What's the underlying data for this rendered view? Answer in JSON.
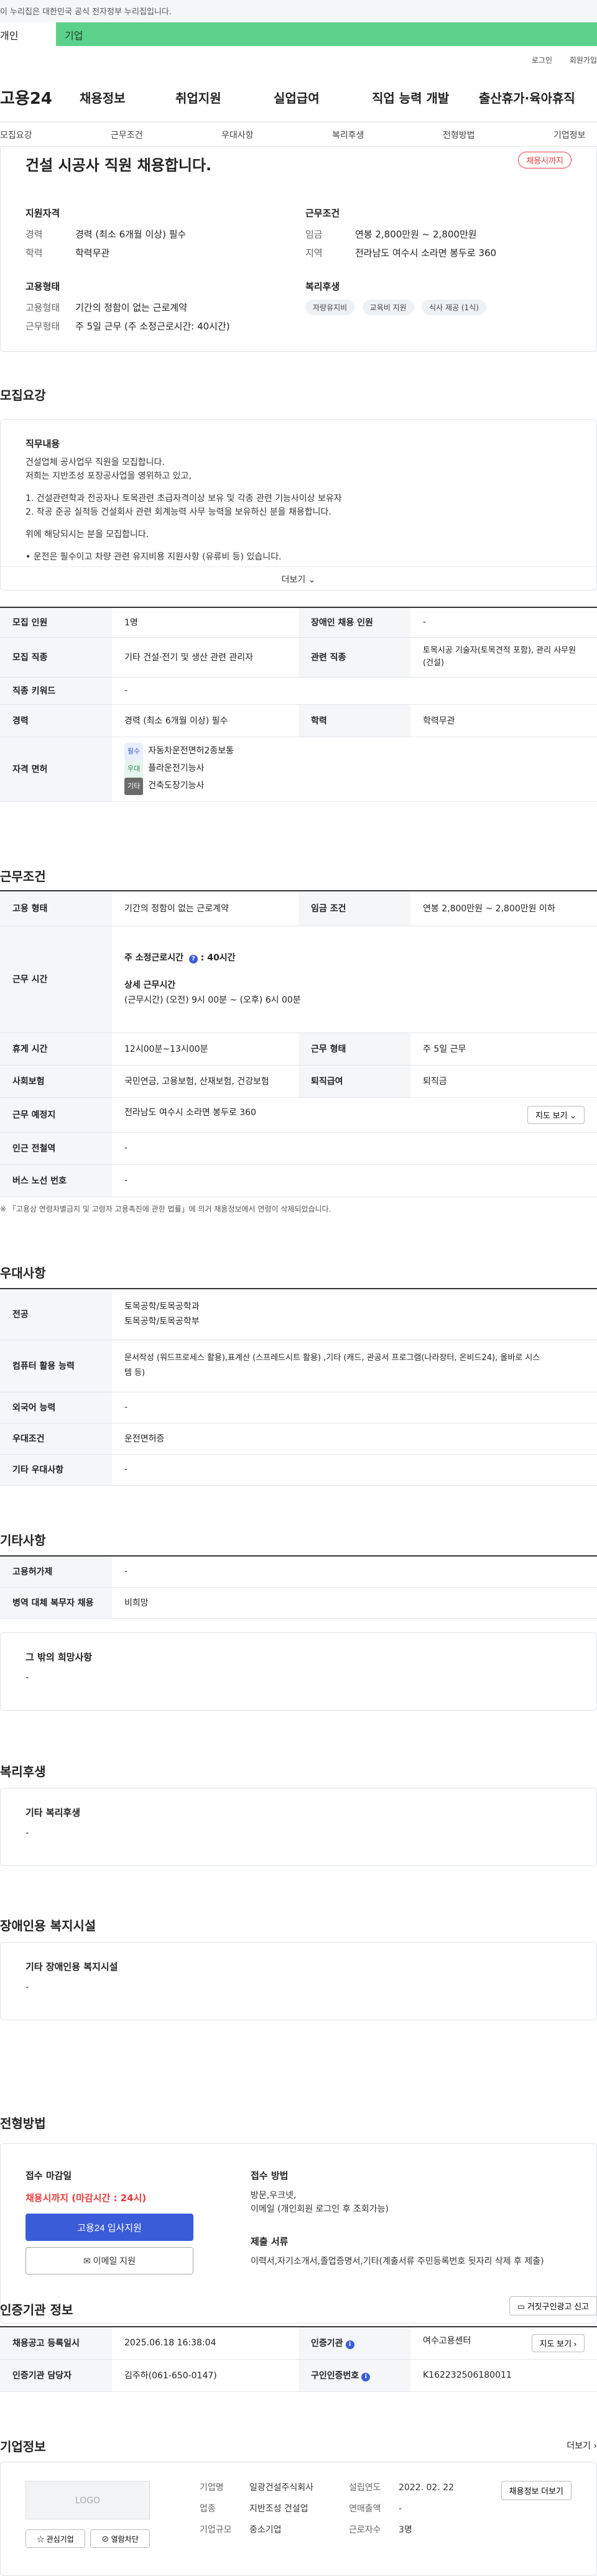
{
  "gov": {
    "notice": "이 누리집은 대한민국 공식 전자정부 누리집입니다.",
    "tab_left": "개인",
    "tab_right": "기업"
  },
  "util": {
    "login": "로그인",
    "signup": "회원가입"
  },
  "gnb": {
    "logo": "고용24",
    "menus": [
      "채용정보",
      "취업지원",
      "실업급여",
      "직업 능력 개발",
      "출산휴가·육아휴직"
    ]
  },
  "lnb": [
    "모집요강",
    "근무조건",
    "우대사항",
    "복리후생",
    "전형방법",
    "기업정보"
  ],
  "summary": {
    "title": "건설 시공사 직원 채용합니다.",
    "badge": "채용시까지",
    "qual_h": "지원자격",
    "career_k": "경력",
    "career_v": "경력 (최소 6개월 이상) 필수",
    "edu_k": "학력",
    "edu_v": "학력무관",
    "cond_h": "근무조건",
    "wage_k": "임금",
    "wage_v": "연봉 2,800만원 ~ 2,800만원",
    "region_k": "지역",
    "region_v": "전라남도 여수시 소라면 봉두로 360",
    "emp_h": "고용형태",
    "type_k": "고용형태",
    "type_v": "기간의 정함이 없는 근로계약",
    "hours_k": "근무형태",
    "hours_v": "주 5일 근무 (주 소정근로시간: 40시간)",
    "welfare_h": "복리후생",
    "chips": [
      "자량유지비",
      "교육비 지원",
      "식사 제공 (1식)"
    ]
  },
  "recruit": {
    "title": "모집요강",
    "job_h": "직무내용",
    "desc": [
      "건설업체 공사업무 직원을 모집합니다.",
      "저희는 지반조성 포장공사업을 영위하고 있고,",
      "",
      "1. 건설관련학과 전공자나 토목관련 초급자격이상 보유 및 각종 관련 기능사이상 보유자",
      "2. 작공 준공 실적등 건설회사 관련 회계능력 사무 능력을 보유하신 분을 채용합니다.",
      "",
      "위에 해당되시는 분을 모집합니다.",
      "",
      "• 운전은 필수이고 차량 관련 유지비용 지원사항 (유류비 등) 있습니다."
    ],
    "more": "더보기",
    "rows": {
      "count_k": "모집 인원",
      "count_v": "1명",
      "disabled_k": "장애인 채용 인원",
      "disabled_v": "-",
      "job_k": "모집 직종",
      "job_v": "기타 건설·전기 및 생산 관련 관리자",
      "rel_k": "관련 직종",
      "rel_v1": "토목시공 기술자(토목견적 포함), 관리 사무원(건설)",
      "kw_k": "직종 키워드",
      "kw_v": "-",
      "career_k": "경력",
      "career_v": "경력 (최소 6개월 이상) 필수",
      "edu_k": "학력",
      "edu_v": "학력무관",
      "lic_k": "자격 면허",
      "licenses": [
        {
          "tag": "필수",
          "name": "자동차운전면허2종보통"
        },
        {
          "tag": "우대",
          "name": "플라운전기능사"
        },
        {
          "tag": "기타",
          "name": "건축도장기능사"
        }
      ]
    }
  },
  "work": {
    "title": "근무조건",
    "type_k": "고용 형태",
    "type_v": "기간의 정함이 없는 근로계약",
    "wage_k": "임금 조건",
    "wage_v": "연봉 2,800만원 ~ 2,800만원 이하",
    "time_k": "근무 시간",
    "weekly_label": "주 소정근로시간",
    "weekly_v": "40시간",
    "detail_label": "상세 근무시간",
    "detail_v": "(근무시간) (오전) 9시 00분 ~ (오후) 6시 00분",
    "rest_k": "휴게 시간",
    "rest_v": "12시00분~13시00분",
    "form_k": "근무 형태",
    "form_v": "주 5일 근무",
    "ins_k": "사회보험",
    "ins_v": "국민연금, 고용보험, 산재보험, 건강보험",
    "ret_k": "퇴직급여",
    "ret_v": "퇴직금",
    "place_k": "근무 예정지",
    "place_v": "전라남도 여수시 소라면 봉두로 360",
    "map_btn": "지도 보기",
    "sub_k": "인근 전철역",
    "sub_v": "-",
    "bus_k": "버스 노선 번호",
    "bus_v": "-",
    "note": "※ 「고용상 연령차별금지 및 고령자 고용촉진에 관한 법률」에 의거 채용정보에서 연령이 삭제되었습니다."
  },
  "pref": {
    "title": "우대사항",
    "major_k": "전공",
    "major_v1": "토목공학/토목공학과",
    "major_v2": "토목공학/토목공학부",
    "pc_k": "컴퓨터 활용 능력",
    "pc_v1": "문서작성 (워드프로세스 활용),표계산 (스프레드시트 활용) ,기타 (캐드, 관공서 프로그램(나라장터, 온비드24), 올바로 시스",
    "pc_v2": "템 등)",
    "lang_k": "외국어 능력",
    "lang_v": "-",
    "cond_k": "우대조건",
    "cond_v": "운전면허증",
    "etc_k": "기타 우대사항",
    "etc_v": "-"
  },
  "other": {
    "title": "기타사항",
    "emp_k": "고용허가제",
    "emp_v": "-",
    "mil_k": "병역 대체 복무자 채용",
    "mil_v": "비희망",
    "hope_h": "그 밖의 희망사항",
    "hope_v": "-"
  },
  "welfare": {
    "title": "복리후생",
    "h": "기타 복리후생",
    "v": "-"
  },
  "disab": {
    "title": "장애인용 복지시설",
    "h": "기타 장애인용 복지시설",
    "v": "-"
  },
  "process": {
    "title": "전형방법",
    "deadline_h": "접수 마감일",
    "deadline_v": "채용시까지 (마감시간 : 24시)",
    "apply_btn": "고용24 입사지원",
    "email_btn": "이메일 지원",
    "method_h": "접수 방법",
    "method_v1": "방문,우크넷,",
    "method_v2": "이메일 (개인회원 로그인 후 조회가능)",
    "docs_h": "제출 서류",
    "docs_v": "이력서,자기소개서,졸업증명서,기타(계출서류 주민등록번호 뒷자리 삭제 후 제출)"
  },
  "agency": {
    "title": "인증기관 정보",
    "report_btn": "거짓구인광고 신고",
    "date_k": "채용공고 등록일시",
    "date_v": "2025.06.18 16:38:04",
    "org_k": "인증기관",
    "org_v": "여수고용센터",
    "map_btn": "지도 보기",
    "staff_k": "인증기관 담당자",
    "staff_v": "김주하(061-650-0147)",
    "num_k": "구인인증번호",
    "num_v": "K162232506180011"
  },
  "company": {
    "title": "기업정보",
    "more": "더보기",
    "logo": "LOGO",
    "fav_btn": "관심기업",
    "block_btn": "열람차단",
    "name_k": "기업명",
    "name_v": "일광건설주식회사",
    "ind_k": "업종",
    "ind_v": "지반조성 건설업",
    "size_k": "기업규모",
    "size_v": "중소기업",
    "est_k": "설립연도",
    "est_v": "2022. 02. 22",
    "sales_k": "연매출액",
    "sales_v": "-",
    "emp_k": "근로자수",
    "emp_v": "3명",
    "list_btn": "채용정보 더보기"
  }
}
